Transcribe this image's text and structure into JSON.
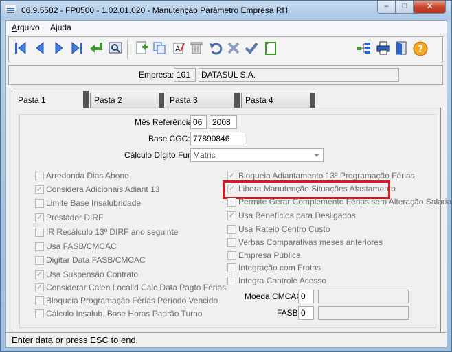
{
  "window": {
    "title": "06.9.5582 - FP0500 - 1.02.01.020 - Manutenção Parâmetro Empresa RH",
    "minimize": "–",
    "maximize": "□",
    "close": "✕"
  },
  "menu": [
    {
      "label": "Arquivo"
    },
    {
      "label": "Ajuda"
    }
  ],
  "toolbar": {
    "icons": [
      "first-record-icon",
      "previous-record-icon",
      "next-record-icon",
      "last-record-icon",
      "goto-icon",
      "search-icon",
      "add-icon",
      "copy-icon",
      "edit-icon",
      "delete-icon",
      "undo-icon",
      "cancel-icon",
      "confirm-icon",
      "new-document-icon",
      "tree-icon",
      "print-icon",
      "exit-icon",
      "help-icon"
    ]
  },
  "header": {
    "empresa_label": "Empresa:",
    "empresa_code": "101",
    "empresa_name": "DATASUL S.A."
  },
  "tabs": [
    {
      "label": "Pasta 1",
      "active": true
    },
    {
      "label": "Pasta 2"
    },
    {
      "label": "Pasta 3"
    },
    {
      "label": "Pasta 4"
    }
  ],
  "form": {
    "mes_label": "Mês Referência:",
    "mes_value": "06",
    "ano_value": "2008",
    "cgc_label": "Base CGC:",
    "cgc_value": "77890846",
    "calc_label": "Cálculo Dígito Func:",
    "calc_value": "Matric",
    "moeda_label": "Moeda CMCAC:",
    "moeda_code": "0",
    "moeda_desc": "",
    "fasb_label": "FASB:",
    "fasb_code": "0",
    "fasb_desc": ""
  },
  "checkboxes_left": [
    {
      "label": "Arredonda Dias Abono",
      "checked": false
    },
    {
      "label": "Considera Adicionais Adiant 13",
      "checked": true
    },
    {
      "label": "Limite Base Insalubridade",
      "checked": false
    },
    {
      "label": "Prestador DIRF",
      "checked": true
    },
    {
      "label": "IR Recálculo 13º DIRF ano seguinte",
      "checked": false
    },
    {
      "label": "Usa FASB/CMCAC",
      "checked": false
    },
    {
      "label": "Digitar Data FASB/CMCAC",
      "checked": false
    },
    {
      "label": "Usa Suspensão Contrato",
      "checked": true
    },
    {
      "label": "Considerar Calen Localid Calc Data Pagto Férias",
      "checked": true
    },
    {
      "label": "Bloqueia Programação Férias Período Vencido",
      "checked": false
    },
    {
      "label": "Cálculo Insalub. Base Horas Padrão Turno",
      "checked": false
    }
  ],
  "checkboxes_right": [
    {
      "label": "Bloqueia Adiantamento 13º Programação Férias",
      "checked": true
    },
    {
      "label": "Libera Manutenção Situações Afastamento",
      "checked": true
    },
    {
      "label": "Permite Gerar Complemento Férias sem Alteração Salaria",
      "checked": false
    },
    {
      "label": "Usa Benefícios para Desligados",
      "checked": true
    },
    {
      "label": "Usa Rateio Centro Custo",
      "checked": false
    },
    {
      "label": "Verbas Comparativas meses anteriores",
      "checked": false
    },
    {
      "label": "Empresa Pública",
      "checked": false
    },
    {
      "label": "Integração com Frotas",
      "checked": false
    },
    {
      "label": "Integra Controle Acesso",
      "checked": false
    }
  ],
  "status": {
    "text": "Enter data or press ESC to end."
  }
}
